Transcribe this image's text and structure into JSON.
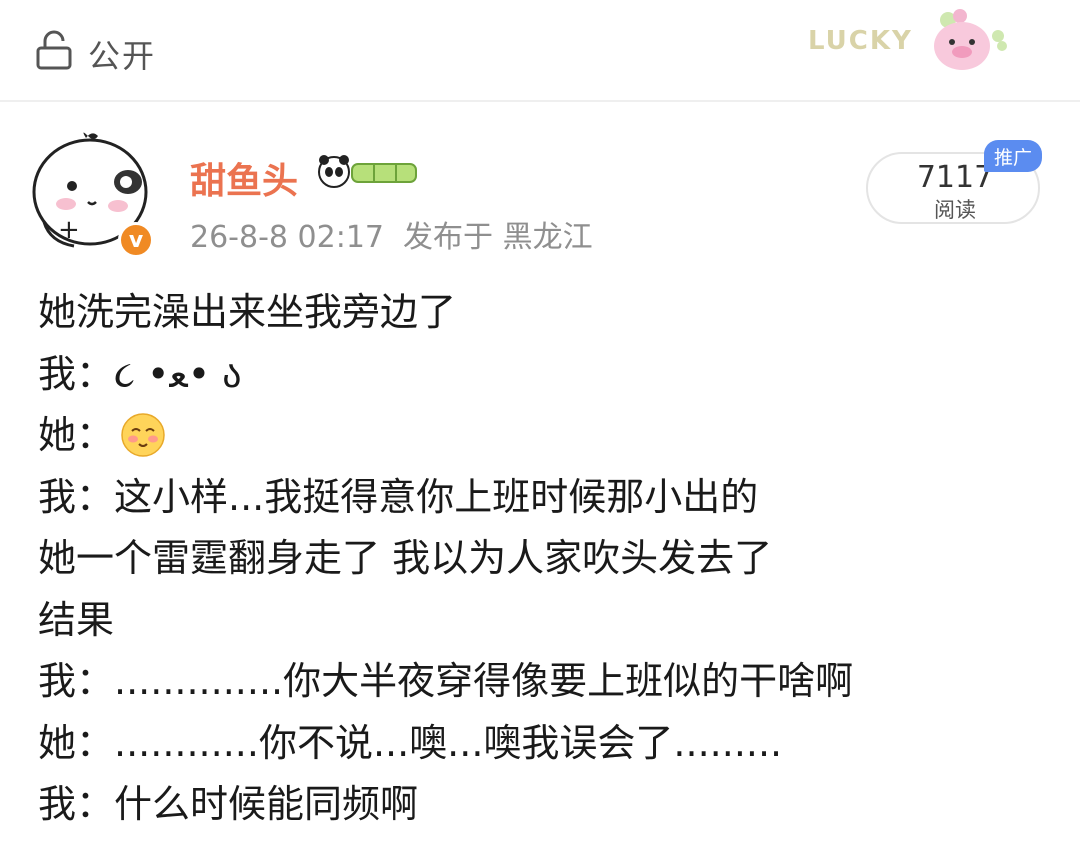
{
  "topbar": {
    "visibility_label": "公开",
    "sticker_text": "LUCKY"
  },
  "post": {
    "username": "甜鱼头",
    "meta": "26-8-8 02:17  发布于 黑龙江",
    "read_count": "7117",
    "read_label": "阅读",
    "promo_badge": "推广",
    "lines": [
      "她洗完澡出来坐我旁边了",
      "我：૮ •ﻌ• ა",
      "她：",
      "我：这小样...我挺得意你上班时候那小出的",
      "她一个雷霆翻身走了 我以为人家吹头发去了",
      "结果",
      "我：..............你大半夜穿得像要上班似的干啥啊",
      "她：............你不说...噢...噢我误会了.........",
      "我：什么时候能同频啊"
    ]
  },
  "colors": {
    "username": "#eb7350",
    "badge_verify": "#f08a24",
    "badge_promo": "#5b8cf0",
    "meta_text": "#8f8f8f"
  },
  "icons": {
    "lock": "lock-icon",
    "verified": "verified-badge-icon",
    "emoji": "blushing-face-emoji"
  }
}
